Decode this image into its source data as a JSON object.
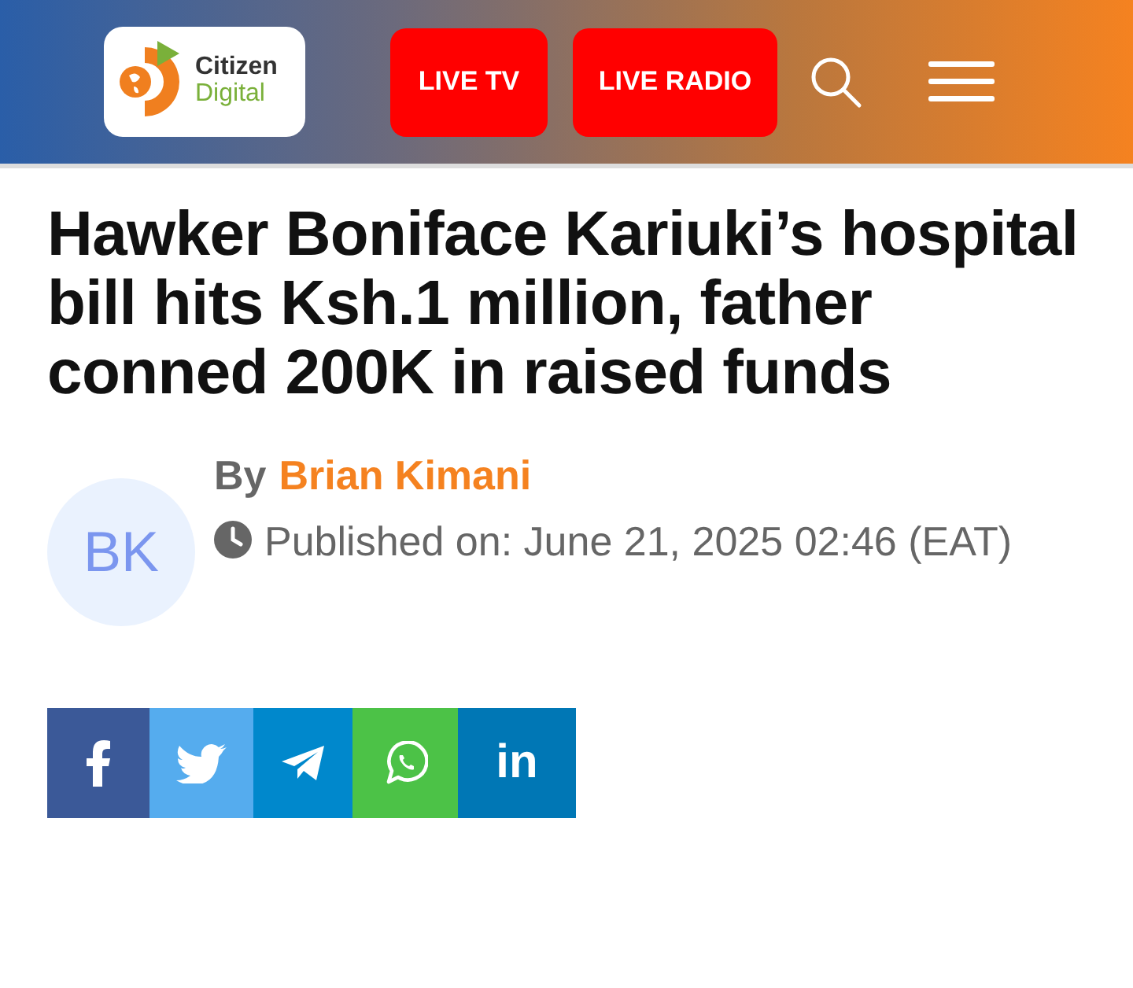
{
  "header": {
    "logo": {
      "line_1": "Citizen",
      "line_2": "Digital"
    },
    "buttons": [
      "LIVE TV",
      "LIVE RADIO"
    ]
  },
  "article": {
    "title": "Hawker Boniface Kariuki’s hospital bill hits Ksh.1 million, father conned 200K in raised funds",
    "author": {
      "initials": "BK",
      "prefix": "By",
      "name": "Brian Kimani"
    },
    "published": "Published on: June 21, 2025 02:46 (EAT)"
  },
  "share": [
    {
      "kind": "facebook",
      "color": "#3b5998"
    },
    {
      "kind": "twitter",
      "color": "#55acee"
    },
    {
      "kind": "telegram",
      "color": "#0088cc"
    },
    {
      "kind": "whatsapp",
      "color": "#4cc247"
    },
    {
      "kind": "linkedin",
      "color": "#0077b5",
      "label": "in"
    }
  ]
}
